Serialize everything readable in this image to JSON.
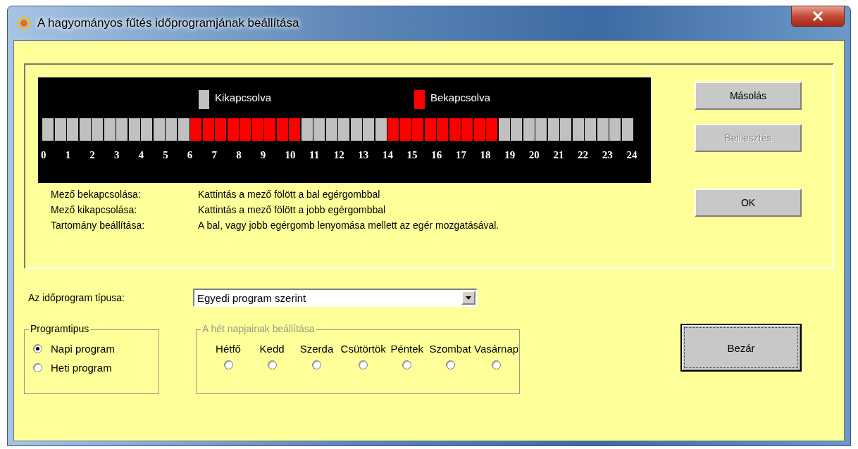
{
  "window": {
    "title": "A hagyományos fűtés időprogramjának beállítása"
  },
  "legend": [
    {
      "label": "Kikapcsolva",
      "on": false
    },
    {
      "label": "Bekapcsolva",
      "on": true
    }
  ],
  "slots": [
    {
      "on": false
    },
    {
      "on": false
    },
    {
      "on": false
    },
    {
      "on": false
    },
    {
      "on": false
    },
    {
      "on": false
    },
    {
      "on": false
    },
    {
      "on": false
    },
    {
      "on": false
    },
    {
      "on": false
    },
    {
      "on": false
    },
    {
      "on": false
    },
    {
      "on": true
    },
    {
      "on": true
    },
    {
      "on": true
    },
    {
      "on": true
    },
    {
      "on": true
    },
    {
      "on": true
    },
    {
      "on": true
    },
    {
      "on": true
    },
    {
      "on": true
    },
    {
      "on": false
    },
    {
      "on": false
    },
    {
      "on": false
    },
    {
      "on": false
    },
    {
      "on": false
    },
    {
      "on": false
    },
    {
      "on": false
    },
    {
      "on": true
    },
    {
      "on": true
    },
    {
      "on": true
    },
    {
      "on": true
    },
    {
      "on": true
    },
    {
      "on": true
    },
    {
      "on": true
    },
    {
      "on": true
    },
    {
      "on": true
    },
    {
      "on": false
    },
    {
      "on": false
    },
    {
      "on": false
    },
    {
      "on": false
    },
    {
      "on": false
    },
    {
      "on": false
    },
    {
      "on": false
    },
    {
      "on": false
    },
    {
      "on": false
    },
    {
      "on": false
    },
    {
      "on": false
    }
  ],
  "hours": [
    "0",
    "1",
    "2",
    "3",
    "4",
    "5",
    "6",
    "7",
    "8",
    "9",
    "10",
    "11",
    "12",
    "13",
    "14",
    "15",
    "16",
    "17",
    "18",
    "19",
    "20",
    "21",
    "22",
    "23",
    "24"
  ],
  "help": [
    {
      "label": "Mező bekapcsolása:",
      "text": "Kattintás a mező fölött a bal egérgombbal"
    },
    {
      "label": "Mező kikapcsolása:",
      "text": "Kattintás a mező fölött a jobb egérgombbal"
    },
    {
      "label": "Tartomány beállítása:",
      "text": "A bal, vagy jobb egérgomb lenyomása mellett az egér mozgatásával."
    }
  ],
  "side_buttons": [
    {
      "label": "Másolás",
      "disabled": false
    },
    {
      "label": "Beillesztés",
      "disabled": true
    },
    {
      "label": "OK",
      "disabled": false
    }
  ],
  "program_type": {
    "label": "Az időprogram típusa:",
    "value": "Egyedi program szerint"
  },
  "program_kind_group": {
    "title": "Programtipus",
    "options": [
      {
        "label": "Napi program",
        "selected": true
      },
      {
        "label": "Heti program",
        "selected": false
      }
    ]
  },
  "weekdays_group": {
    "title": "A hét napjainak beállítása",
    "disabled": true,
    "days": [
      {
        "label": "Hétfő",
        "selected": false
      },
      {
        "label": "Kedd",
        "selected": false
      },
      {
        "label": "Szerda",
        "selected": false
      },
      {
        "label": "Csütörtök",
        "selected": false
      },
      {
        "label": "Péntek",
        "selected": false
      },
      {
        "label": "Szombat",
        "selected": false
      },
      {
        "label": "Vasárnap",
        "selected": false
      }
    ]
  },
  "close_button": {
    "label": "Bezár"
  }
}
